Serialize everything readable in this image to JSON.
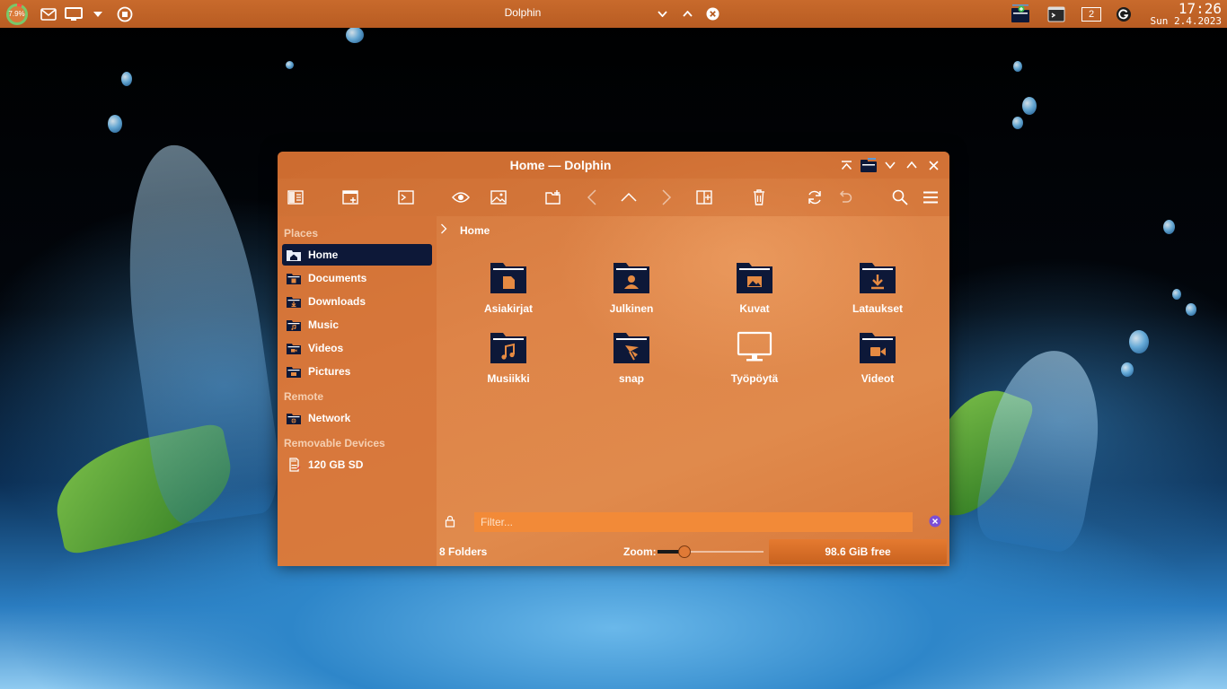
{
  "panel": {
    "cpu_label": "7.9%",
    "active_window_title": "Dolphin",
    "virtual_desktop": "2",
    "clock_time": "17:26",
    "clock_date": "Sun 2.4.2023"
  },
  "window": {
    "title": "Home — Dolphin",
    "accent_color": "#0d1838",
    "sidebar": {
      "sections": [
        {
          "title": "Places",
          "items": [
            {
              "label": "Home",
              "icon": "home-folder-icon",
              "selected": true
            },
            {
              "label": "Documents",
              "icon": "documents-folder-icon"
            },
            {
              "label": "Downloads",
              "icon": "downloads-folder-icon"
            },
            {
              "label": "Music",
              "icon": "music-folder-icon"
            },
            {
              "label": "Videos",
              "icon": "videos-folder-icon"
            },
            {
              "label": "Pictures",
              "icon": "pictures-folder-icon"
            }
          ]
        },
        {
          "title": "Remote",
          "items": [
            {
              "label": "Network",
              "icon": "network-folder-icon"
            }
          ]
        },
        {
          "title": "Removable Devices",
          "items": [
            {
              "label": "120 GB SD",
              "icon": "sd-card-icon"
            }
          ]
        }
      ]
    },
    "breadcrumb": {
      "current": "Home"
    },
    "folders": [
      {
        "name": "Asiakirjat",
        "icon": "documents-folder-icon"
      },
      {
        "name": "Julkinen",
        "icon": "public-folder-icon"
      },
      {
        "name": "Kuvat",
        "icon": "pictures-folder-icon"
      },
      {
        "name": "Lataukset",
        "icon": "downloads-folder-icon"
      },
      {
        "name": "Musiikki",
        "icon": "music-folder-icon"
      },
      {
        "name": "snap",
        "icon": "snap-folder-icon"
      },
      {
        "name": "Työpöytä",
        "icon": "desktop-monitor-icon"
      },
      {
        "name": "Videot",
        "icon": "videos-folder-icon"
      }
    ],
    "filter": {
      "placeholder": "Filter..."
    },
    "status": {
      "count": "8 Folders",
      "zoom_label": "Zoom:",
      "zoom_level": 0.25,
      "free_space": "98.6 GiB free"
    }
  }
}
